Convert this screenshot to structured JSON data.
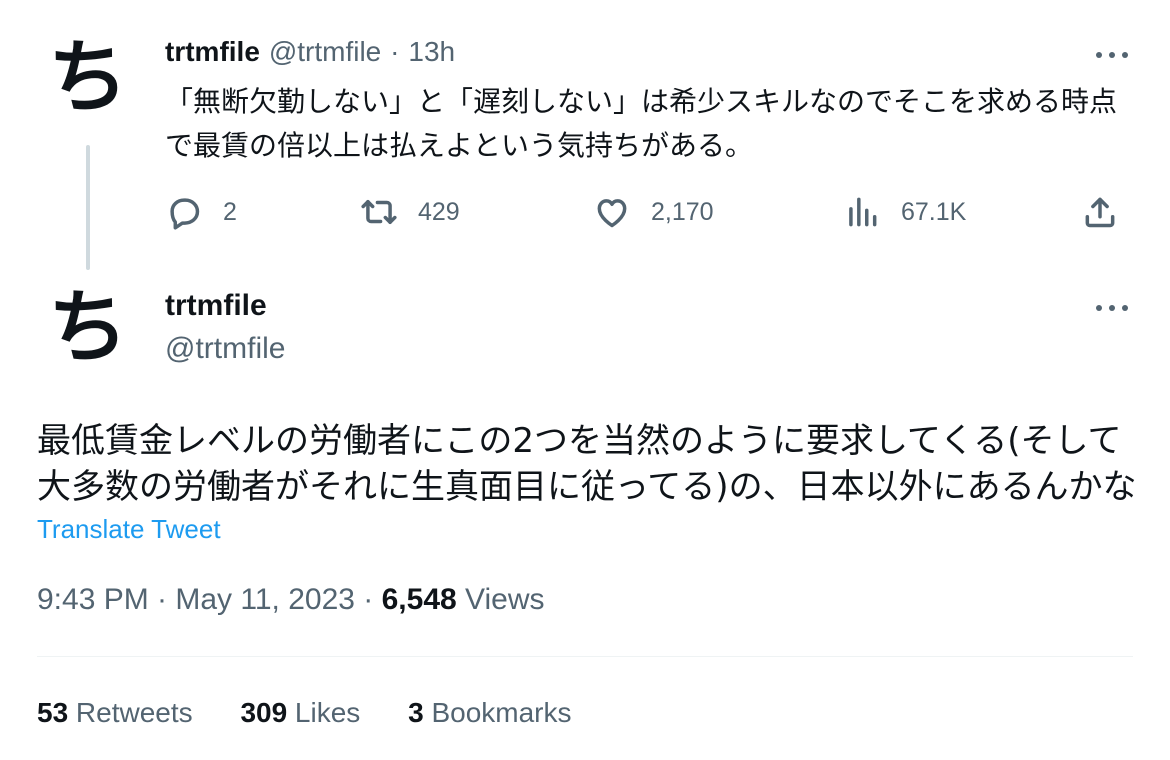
{
  "thread_tweet": {
    "avatar_glyph": "ち",
    "display_name": "trtmfile",
    "handle": "@trtmfile",
    "separator": "·",
    "time": "13h",
    "text": "「無断欠勤しない」と「遅刻しない」は希少スキルなのでそこを求める時点で最賃の倍以上は払えよという気持ちがある。",
    "actions": {
      "reply_count": "2",
      "retweet_count": "429",
      "like_count": "2,170",
      "views_count": "67.1K"
    }
  },
  "main_tweet": {
    "avatar_glyph": "ち",
    "display_name": "trtmfile",
    "handle": "@trtmfile",
    "text": "最低賃金レベルの労働者にこの2つを当然のように要求してくる(そして大多数の労働者がそれに生真面目に従ってる)の、日本以外にあるんかな",
    "translate_label": "Translate Tweet",
    "timestamp": "9:43 PM · May 11, 2023 · ",
    "views_count": "6,548",
    "views_label": " Views",
    "stats": {
      "retweets_count": "53",
      "retweets_label": " Retweets",
      "likes_count": "309",
      "likes_label": " Likes",
      "bookmarks_count": "3",
      "bookmarks_label": " Bookmarks"
    }
  },
  "icons": {
    "reply": "reply-icon",
    "retweet": "retweet-icon",
    "like": "heart-icon",
    "views": "views-icon",
    "share": "share-icon",
    "more": "more-icon"
  },
  "colors": {
    "text": "#0f1419",
    "muted": "#536471",
    "link": "#1d9bf0",
    "thread_line": "#cfd9de"
  }
}
